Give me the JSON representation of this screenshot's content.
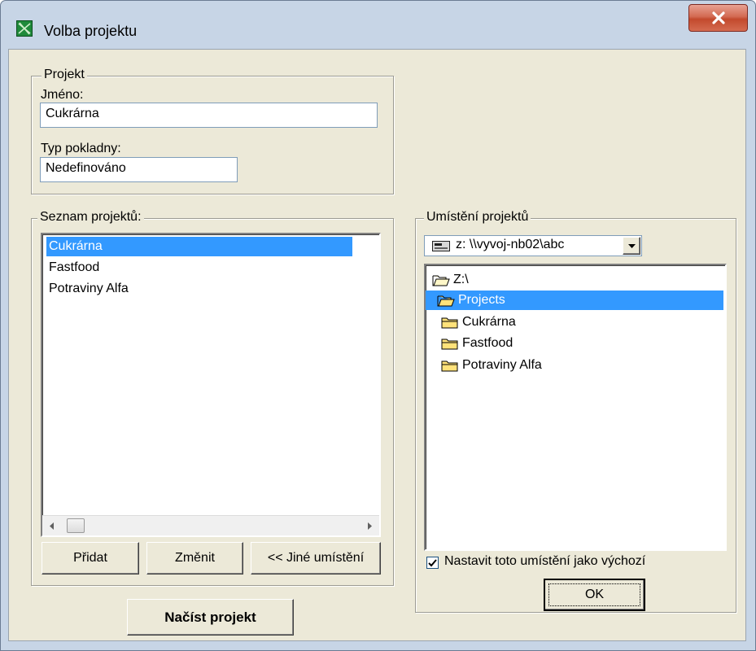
{
  "window": {
    "title": "Volba projektu"
  },
  "projekt": {
    "legend": "Projekt",
    "name_label": "Jméno:",
    "name_value": "Cukrárna",
    "type_label": "Typ pokladny:",
    "type_value": "Nedefinováno"
  },
  "seznam": {
    "legend": "Seznam projektů:",
    "items": [
      "Cukrárna",
      "Fastfood",
      "Potraviny Alfa"
    ],
    "selected_index": 0
  },
  "buttons": {
    "pridat": "Přidat",
    "zmenit": "Změnit",
    "jine": "<< Jiné umístění",
    "nacist": "Načíst projekt",
    "ok": "OK"
  },
  "umisteni": {
    "legend": "Umístění projektů",
    "drive": "z: \\\\vyvoj-nb02\\abc",
    "tree": [
      {
        "label": "Z:\\",
        "icon": "open-folder-icon",
        "level": 0
      },
      {
        "label": "Projects",
        "icon": "open-folder-icon",
        "level": 1,
        "selected": true
      },
      {
        "label": "Cukrárna",
        "icon": "folder-icon",
        "level": 2
      },
      {
        "label": "Fastfood",
        "icon": "folder-icon",
        "level": 2
      },
      {
        "label": "Potraviny Alfa",
        "icon": "folder-icon",
        "level": 2
      }
    ],
    "default_checkbox_label": "Nastavit toto umístění jako výchozí",
    "default_checked": true
  },
  "colors": {
    "selection": "#3399ff",
    "dialog_bg": "#ece9d8",
    "folder_yellow": "#ffe27a"
  }
}
